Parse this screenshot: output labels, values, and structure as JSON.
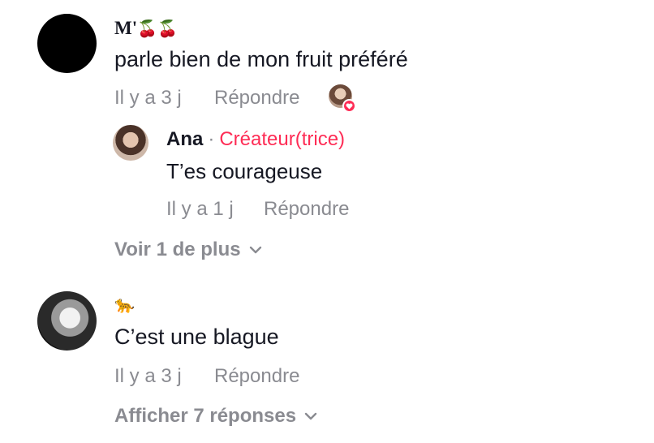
{
  "comments": [
    {
      "username": "M'",
      "username_emoji": "🍒🍒",
      "text": "parle bien de mon fruit préféré",
      "time": "Il y a 3 j",
      "reply_label": "Répondre",
      "reply": {
        "username": "Ana",
        "separator": "·",
        "badge": "Créateur(trice)",
        "text": "T’es courageuse",
        "time": "Il y a 1 j",
        "reply_label": "Répondre"
      },
      "more_label": "Voir 1 de plus"
    },
    {
      "username_emoji": "🐆",
      "text": "C’est une blague",
      "time": "Il y a 3 j",
      "reply_label": "Répondre",
      "more_label": "Afficher 7 réponses"
    }
  ],
  "colors": {
    "creator": "#fe2c55",
    "secondary_text": "#8a8b91",
    "primary_text": "#161823"
  }
}
